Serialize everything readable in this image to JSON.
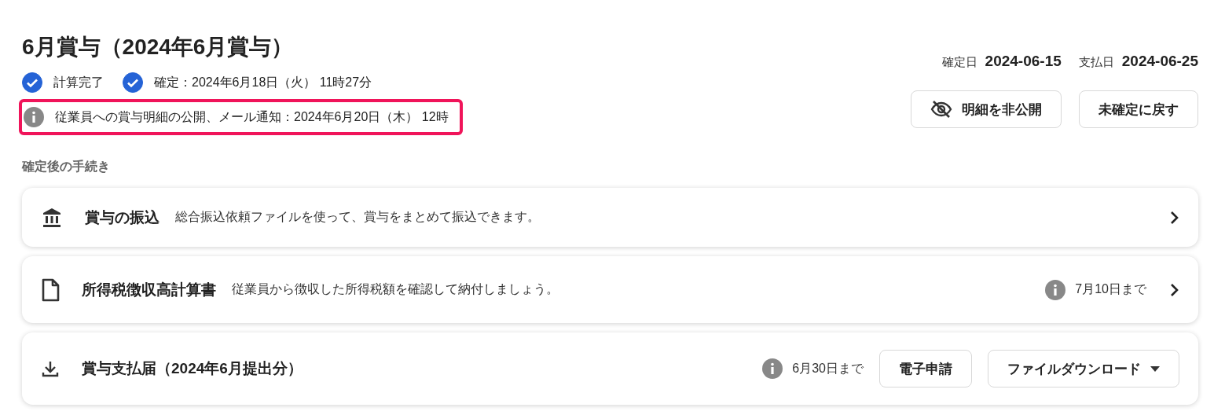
{
  "title": "6月賞与（2024年6月賞与）",
  "statuses": [
    {
      "label": "計算完了",
      "checked": true
    },
    {
      "label": "確定：2024年6月18日（火） 11時27分",
      "checked": true
    }
  ],
  "notice": {
    "text": "従業員への賞与明細の公開、メール通知：2024年6月20日（木） 12時",
    "highlighted": true
  },
  "dates": [
    {
      "label": "確定日",
      "value": "2024-06-15"
    },
    {
      "label": "支払日",
      "value": "2024-06-25"
    }
  ],
  "header_buttons": [
    {
      "label": "明細を非公開",
      "kind": "hide"
    },
    {
      "label": "未確定に戻す",
      "kind": "plain"
    }
  ],
  "section_title": "確定後の手続き",
  "procedures": [
    {
      "kind": "link",
      "title": "賞与の振込",
      "description": "総合振込依頼ファイルを使って、賞与をまとめて振込できます。"
    },
    {
      "kind": "link",
      "title": "所得税徴収高計算書",
      "description": "従業員から徴収した所得税額を確認して納付しましょう。",
      "deadline": "7月10日まで"
    },
    {
      "kind": "actions",
      "title": "賞与支払届（2024年6月提出分）",
      "deadline": "6月30日まで",
      "buttons": [
        {
          "label": "電子申請",
          "kind": "plain"
        },
        {
          "label": "ファイルダウンロード",
          "kind": "dropdown"
        }
      ]
    }
  ]
}
